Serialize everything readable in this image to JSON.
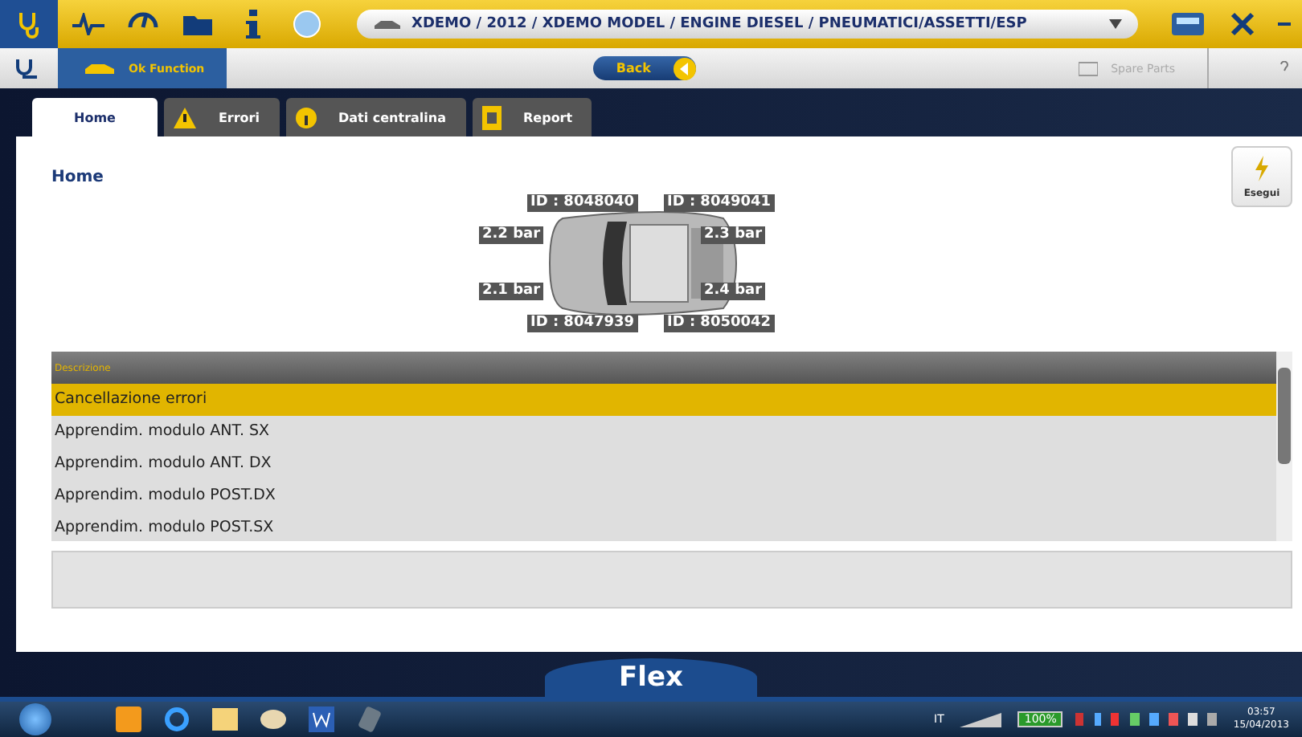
{
  "breadcrumb": "XDEMO / 2012 / XDEMO MODEL / ENGINE DIESEL / PNEUMATICI/ASSETTI/ESP",
  "toolbar": {
    "function_button": "Ok Function",
    "back_button": "Back",
    "spare_parts": "Spare Parts",
    "disabled_spare_parts": true
  },
  "tabs": [
    {
      "label": "Home",
      "kind": "plain",
      "selected": true
    },
    {
      "label": "Errori",
      "kind": "warning",
      "selected": false
    },
    {
      "label": "Dati centralina",
      "kind": "info",
      "selected": false
    },
    {
      "label": "Report",
      "kind": "document",
      "selected": false
    }
  ],
  "page_title": "Home",
  "run_button": "Esegui",
  "wheels": [
    {
      "id": "ID : 8048040",
      "pressure": "2.2 bar"
    },
    {
      "id": "ID : 8049041",
      "pressure": "2.3 bar"
    },
    {
      "id": "ID : 8047939",
      "pressure": "2.1 bar"
    },
    {
      "id": "ID : 8050042",
      "pressure": "2.4 bar"
    }
  ],
  "table": {
    "column": "Descrizione",
    "rows": [
      {
        "text": "Cancellazione errori",
        "selected": true
      },
      {
        "text": "Apprendim. modulo ANT. SX",
        "selected": false
      },
      {
        "text": "Apprendim. modulo ANT. DX",
        "selected": false
      },
      {
        "text": "Apprendim. modulo POST.DX",
        "selected": false
      },
      {
        "text": "Apprendim. modulo POST.SX",
        "selected": false
      }
    ]
  },
  "footer": "Flex",
  "taskbar": {
    "language": "IT",
    "battery": "100%",
    "time": "03:57",
    "date": "15/04/2013"
  }
}
